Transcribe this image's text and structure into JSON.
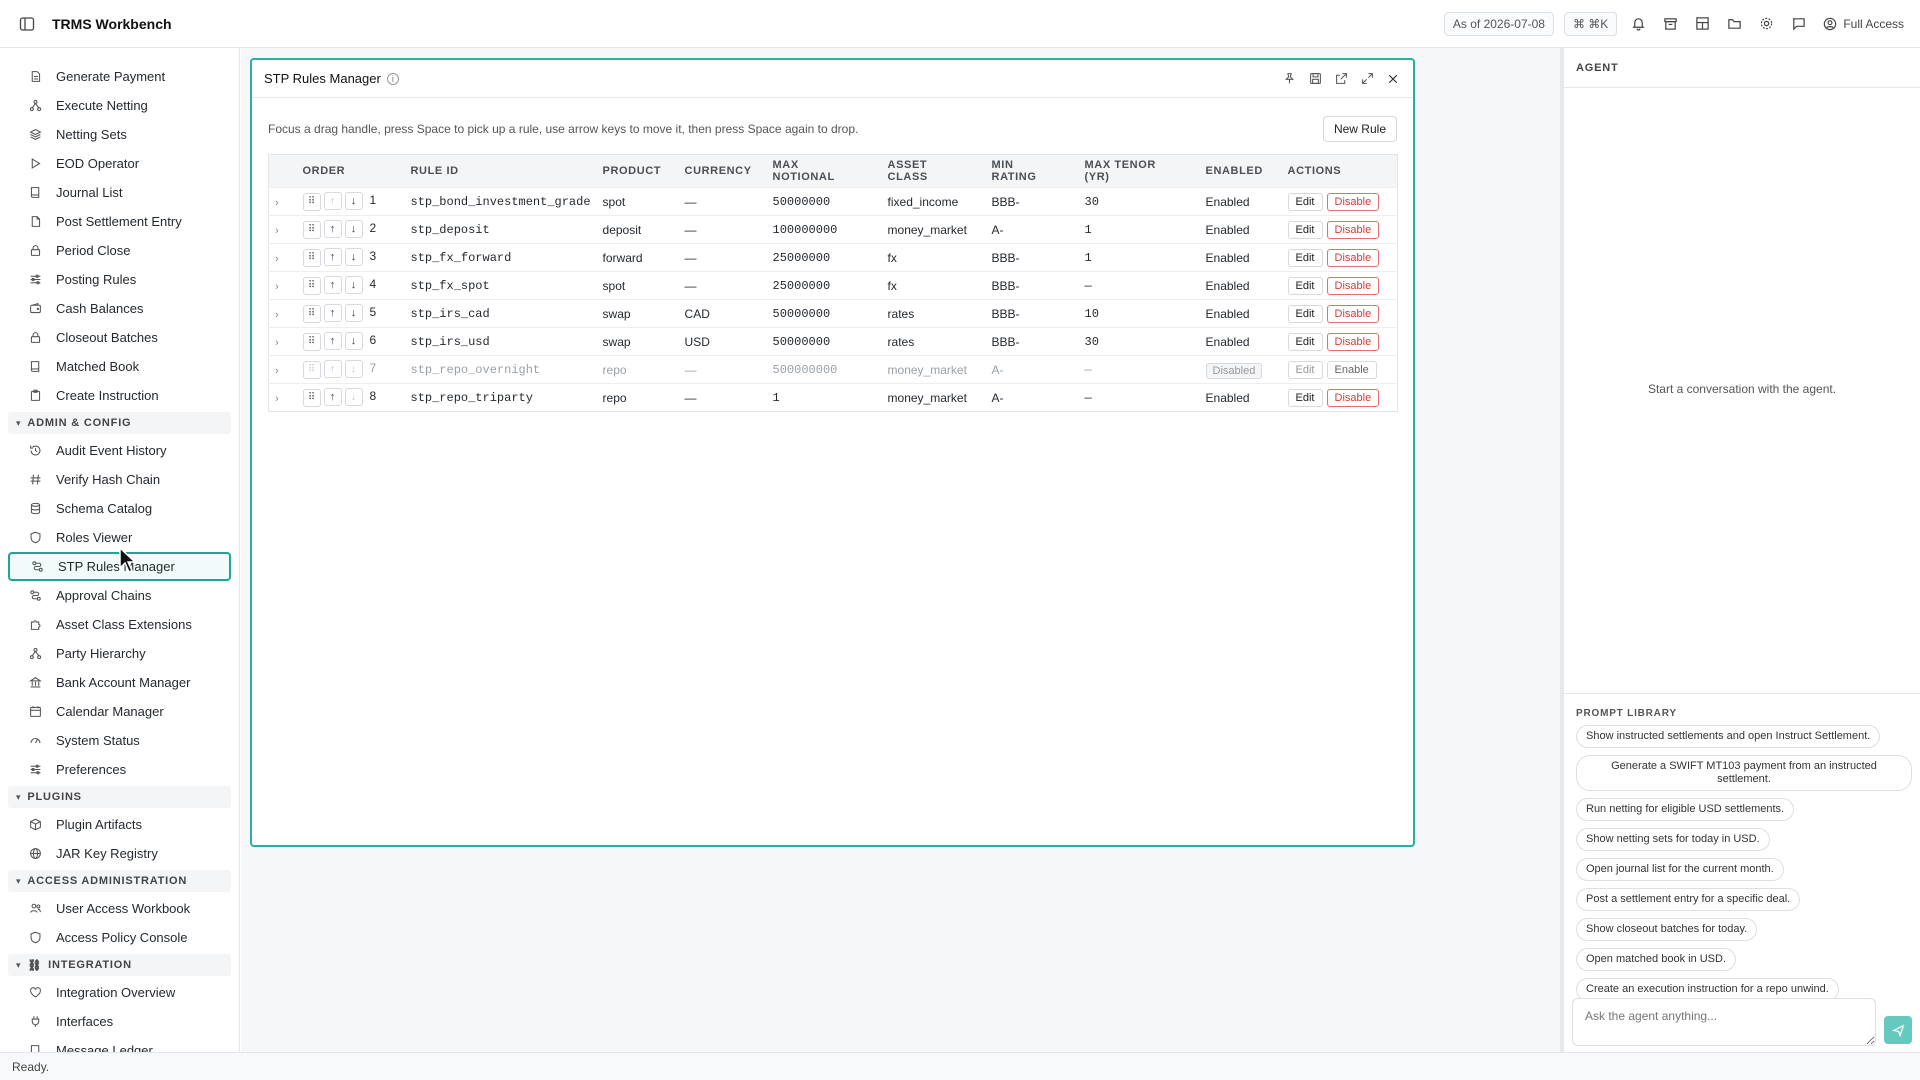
{
  "app": {
    "title": "TRMS Workbench"
  },
  "topbar": {
    "as_of": "As of 2026-07-08",
    "shortcut": "⌘ ⌘K",
    "access": "Full Access"
  },
  "sidebar": {
    "items_top": [
      {
        "label": "Generate Payment",
        "icon": "document-icon"
      },
      {
        "label": "Execute Netting",
        "icon": "network-icon"
      },
      {
        "label": "Netting Sets",
        "icon": "layers-icon"
      },
      {
        "label": "EOD Operator",
        "icon": "play-icon"
      },
      {
        "label": "Journal List",
        "icon": "book-icon"
      },
      {
        "label": "Post Settlement Entry",
        "icon": "file-icon"
      },
      {
        "label": "Period Close",
        "icon": "lock-icon"
      },
      {
        "label": "Posting Rules",
        "icon": "sliders-icon"
      },
      {
        "label": "Cash Balances",
        "icon": "wallet-icon"
      },
      {
        "label": "Closeout Batches",
        "icon": "lock-icon"
      },
      {
        "label": "Matched Book",
        "icon": "book-icon"
      },
      {
        "label": "Create Instruction",
        "icon": "clipboard-icon"
      }
    ],
    "section_admin": "ADMIN & CONFIG",
    "items_admin": [
      {
        "label": "Audit Event History",
        "icon": "history-icon"
      },
      {
        "label": "Verify Hash Chain",
        "icon": "hash-icon"
      },
      {
        "label": "Schema Catalog",
        "icon": "database-icon"
      },
      {
        "label": "Roles Viewer",
        "icon": "shield-icon"
      },
      {
        "label": "STP Rules Manager",
        "icon": "route-icon"
      },
      {
        "label": "Approval Chains",
        "icon": "route-icon"
      },
      {
        "label": "Asset Class Extensions",
        "icon": "puzzle-icon"
      },
      {
        "label": "Party Hierarchy",
        "icon": "network-icon"
      },
      {
        "label": "Bank Account Manager",
        "icon": "bank-icon"
      },
      {
        "label": "Calendar Manager",
        "icon": "calendar-icon"
      },
      {
        "label": "System Status",
        "icon": "gauge-icon"
      },
      {
        "label": "Preferences",
        "icon": "sliders-icon"
      }
    ],
    "section_plugins": "PLUGINS",
    "items_plugins": [
      {
        "label": "Plugin Artifacts",
        "icon": "package-icon"
      },
      {
        "label": "JAR Key Registry",
        "icon": "globe-icon"
      }
    ],
    "section_access": "ACCESS ADMINISTRATION",
    "items_access": [
      {
        "label": "User Access Workbook",
        "icon": "users-icon"
      },
      {
        "label": "Access Policy Console",
        "icon": "shield-icon"
      }
    ],
    "section_integration": "INTEGRATION",
    "items_integration": [
      {
        "label": "Integration Overview",
        "icon": "heart-icon"
      },
      {
        "label": "Interfaces",
        "icon": "plug-icon"
      },
      {
        "label": "Message Ledger",
        "icon": "book-icon"
      }
    ]
  },
  "panel": {
    "title": "STP Rules Manager",
    "hint": "Focus a drag handle, press Space to pick up a rule, use arrow keys to move it, then press Space again to drop.",
    "new_rule": "New Rule",
    "columns": {
      "order": "ORDER",
      "rule_id": "RULE ID",
      "product": "PRODUCT",
      "currency": "CURRENCY",
      "max_notional_1": "MAX",
      "max_notional_2": "NOTIONAL",
      "asset_class_1": "ASSET",
      "asset_class_2": "CLASS",
      "min_rating_1": "MIN",
      "min_rating_2": "RATING",
      "max_tenor_1": "MAX TENOR",
      "max_tenor_2": "(YR)",
      "enabled": "ENABLED",
      "actions": "ACTIONS"
    },
    "edit_label": "Edit",
    "disable_label": "Disable",
    "enable_label": "Enable",
    "rows": [
      {
        "order": "1",
        "rule_id": "stp_bond_investment_grade",
        "product": "spot",
        "currency": "—",
        "max_notional": "50000000",
        "asset_class": "fixed_income",
        "min_rating": "BBB-",
        "max_tenor": "30",
        "enabled": "Enabled",
        "is_enabled": true
      },
      {
        "order": "2",
        "rule_id": "stp_deposit",
        "product": "deposit",
        "currency": "—",
        "max_notional": "100000000",
        "asset_class": "money_market",
        "min_rating": "A-",
        "max_tenor": "1",
        "enabled": "Enabled",
        "is_enabled": true
      },
      {
        "order": "3",
        "rule_id": "stp_fx_forward",
        "product": "forward",
        "currency": "—",
        "max_notional": "25000000",
        "asset_class": "fx",
        "min_rating": "BBB-",
        "max_tenor": "1",
        "enabled": "Enabled",
        "is_enabled": true
      },
      {
        "order": "4",
        "rule_id": "stp_fx_spot",
        "product": "spot",
        "currency": "—",
        "max_notional": "25000000",
        "asset_class": "fx",
        "min_rating": "BBB-",
        "max_tenor": "—",
        "enabled": "Enabled",
        "is_enabled": true
      },
      {
        "order": "5",
        "rule_id": "stp_irs_cad",
        "product": "swap",
        "currency": "CAD",
        "max_notional": "50000000",
        "asset_class": "rates",
        "min_rating": "BBB-",
        "max_tenor": "10",
        "enabled": "Enabled",
        "is_enabled": true
      },
      {
        "order": "6",
        "rule_id": "stp_irs_usd",
        "product": "swap",
        "currency": "USD",
        "max_notional": "50000000",
        "asset_class": "rates",
        "min_rating": "BBB-",
        "max_tenor": "30",
        "enabled": "Enabled",
        "is_enabled": true
      },
      {
        "order": "7",
        "rule_id": "stp_repo_overnight",
        "product": "repo",
        "currency": "—",
        "max_notional": "500000000",
        "asset_class": "money_market",
        "min_rating": "A-",
        "max_tenor": "—",
        "enabled": "Disabled",
        "is_enabled": false
      },
      {
        "order": "8",
        "rule_id": "stp_repo_triparty",
        "product": "repo",
        "currency": "—",
        "max_notional": "1",
        "asset_class": "money_market",
        "min_rating": "A-",
        "max_tenor": "—",
        "enabled": "Enabled",
        "is_enabled": true
      }
    ]
  },
  "agent": {
    "title": "AGENT",
    "empty": "Start a conversation with the agent.",
    "prompt_library_title": "PROMPT LIBRARY",
    "prompts": [
      "Show instructed settlements and open Instruct Settlement.",
      "Generate a SWIFT MT103 payment from an instructed settlement.",
      "Run netting for eligible USD settlements.",
      "Show netting sets for today in USD.",
      "Open journal list for the current month.",
      "Post a settlement entry for a specific deal.",
      "Show closeout batches for today.",
      "Open matched book in USD.",
      "Create an execution instruction for a repo unwind."
    ],
    "composer_placeholder": "Ask the agent anything..."
  },
  "status": {
    "text": "Ready."
  },
  "colors": {
    "accent": "#26b0a4",
    "danger": "#d33a3a"
  }
}
